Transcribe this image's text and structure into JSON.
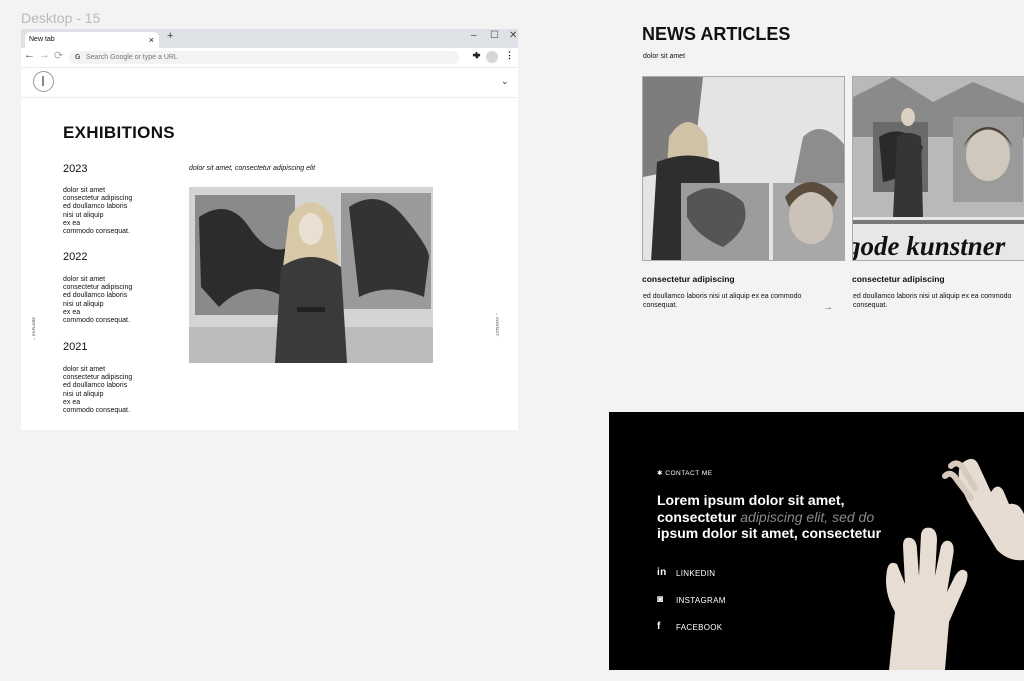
{
  "canvas": {
    "frame_label": "Desktop - 15"
  },
  "browser": {
    "tab_title": "New tab",
    "tab_close": "×",
    "new_tab": "+",
    "win_min": "–",
    "win_max": "☐",
    "win_close": "✕",
    "nav_back": "←",
    "nav_forward": "→",
    "nav_reload": "⟳",
    "omnibox_g": "G",
    "omnibox_placeholder": "Search Google or type a URL",
    "menu": "⋮"
  },
  "site": {
    "header_chevron": "⌄",
    "title": "EXHIBITIONS",
    "caption": "dolor sit amet, consectetur adipiscing elit",
    "side_left": "←  EXPLORE",
    "side_right": "→  CONTACT",
    "years": [
      {
        "year": "2023",
        "text": "dolor sit amet\nconsectetur adipiscing\ned doullamco laboris\nnisi ut aliquip\nex ea\ncommodo consequat."
      },
      {
        "year": "2022",
        "text": "dolor sit amet\nconsectetur adipiscing\ned doullamco laboris\nnisi ut aliquip\nex ea\ncommodo consequat."
      },
      {
        "year": "2021",
        "text": "dolor sit amet\nconsectetur adipiscing\ned doullamco laboris\nnisi ut aliquip\nex ea\ncommodo consequat."
      }
    ]
  },
  "news": {
    "title": "NEWS ARTICLES",
    "subtitle": "dolor sit amet",
    "arrow": "→",
    "cards": [
      {
        "title": "consectetur adipiscing",
        "text": "ed doullamco laboris nisi ut aliquip ex ea commodo consequat."
      },
      {
        "title": "consectetur adipiscing",
        "text": "ed doullamco laboris nisi ut aliquip ex ea commodo consequat.",
        "image_text": "gode kunstner"
      }
    ]
  },
  "contact": {
    "label": "✱ CONTACT ME",
    "headline_1": "Lorem ipsum dolor sit amet,",
    "headline_2a": "consectetur ",
    "headline_2b": "adipiscing elit, sed do",
    "headline_3": "ipsum dolor sit amet, consectetur",
    "social": [
      {
        "icon": "in",
        "label": "LINKEDIN"
      },
      {
        "icon": "◙",
        "label": "INSTAGRAM"
      },
      {
        "icon": "f",
        "label": "FACEBOOK"
      }
    ]
  },
  "colors": {
    "canvas": "#f3f3f3",
    "contact_bg": "#000000",
    "muted_text": "#8a8a8a"
  }
}
